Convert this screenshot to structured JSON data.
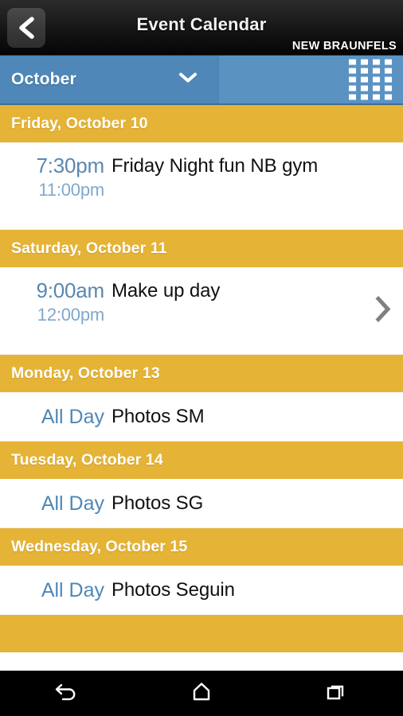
{
  "titlebar": {
    "back_icon": "chevron-left-icon",
    "title": "Event Calendar",
    "org": "NEW BRAUNFELS"
  },
  "monthbar": {
    "month": "October",
    "caret_icon": "chevron-down-icon",
    "grid_icon": "grid-view-icon",
    "accent_blue": "#5a93c2",
    "select_blue": "#4e87b8"
  },
  "agenda": {
    "header_gold": "#e5b335",
    "time_start_color": "#5b87b0",
    "time_end_color": "#7fa8cd",
    "allday_color": "#4f87b8",
    "days": [
      {
        "header": "Friday, October 10",
        "events": [
          {
            "all_day": false,
            "start": "7:30pm",
            "end": "11:00pm",
            "title": "Friday Night fun NB gym",
            "chevron": false
          }
        ]
      },
      {
        "header": "Saturday, October 11",
        "events": [
          {
            "all_day": false,
            "start": "9:00am",
            "end": "12:00pm",
            "title": "Make up day",
            "chevron": true
          }
        ]
      },
      {
        "header": "Monday, October 13",
        "events": [
          {
            "all_day": true,
            "start": "All Day",
            "end": "",
            "title": "Photos SM",
            "chevron": false
          }
        ]
      },
      {
        "header": "Tuesday, October 14",
        "events": [
          {
            "all_day": true,
            "start": "All Day",
            "end": "",
            "title": "Photos SG",
            "chevron": false
          }
        ]
      },
      {
        "header": "Wednesday, October 15",
        "events": [
          {
            "all_day": true,
            "start": "All Day",
            "end": "",
            "title": "Photos Seguin",
            "chevron": false
          }
        ]
      },
      {
        "header": "",
        "events": []
      }
    ]
  },
  "navbar": {
    "back_icon": "android-back-icon",
    "home_icon": "android-home-icon",
    "recents_icon": "android-recents-icon"
  }
}
